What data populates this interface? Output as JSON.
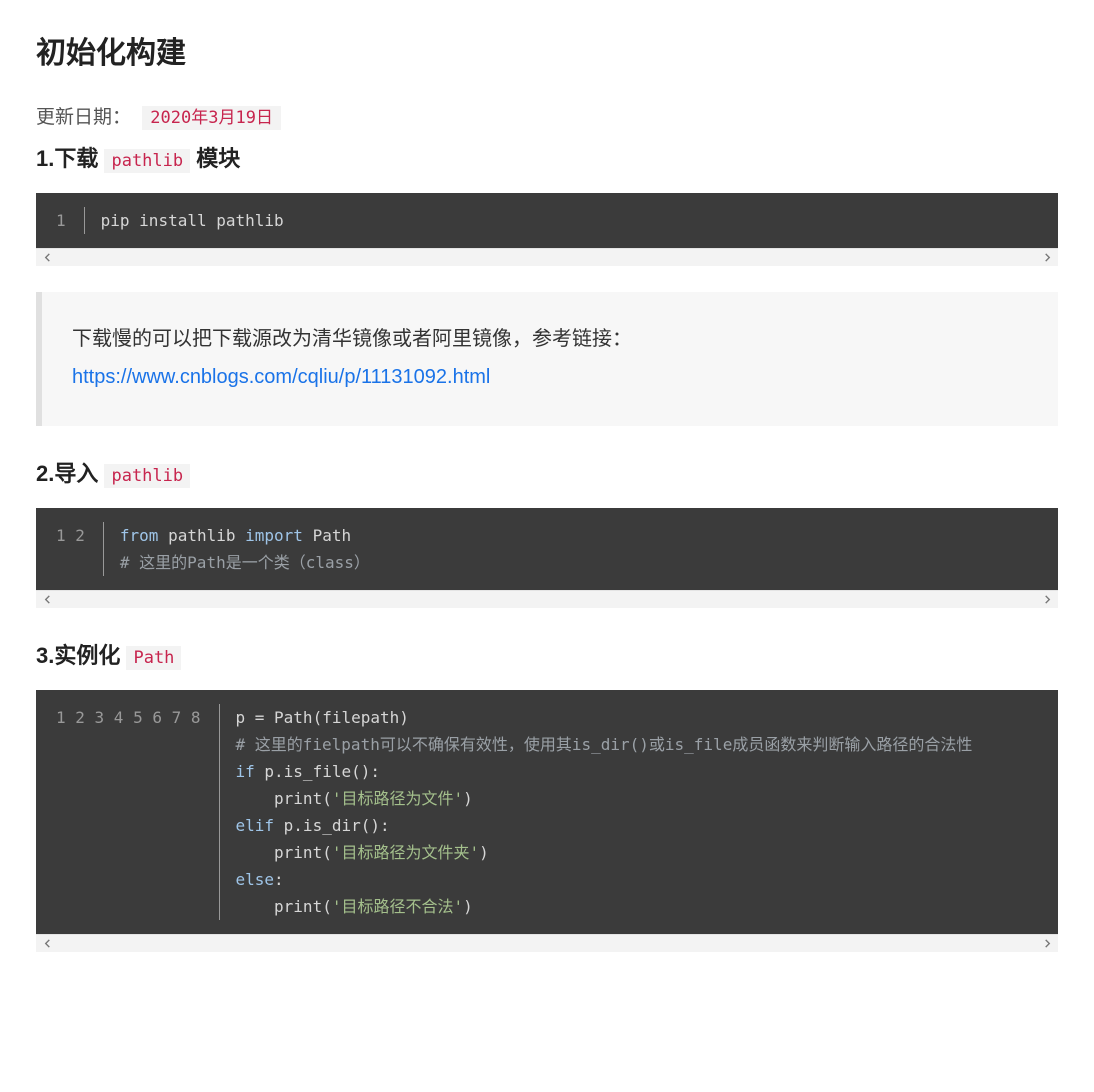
{
  "title": "初始化构建",
  "update_label": "更新日期：",
  "update_date": "2020年3月19日",
  "sections": {
    "s1": {
      "heading_prefix": "1.下载 ",
      "heading_code": "pathlib",
      "heading_suffix": " 模块",
      "code": {
        "gutter": "1",
        "lines": [
          {
            "plain": "pip install pathlib"
          }
        ]
      },
      "note_text": "下载慢的可以把下载源改为清华镜像或者阿里镜像，参考链接：",
      "note_link": "https://www.cnblogs.com/cqliu/p/11131092.html"
    },
    "s2": {
      "heading_prefix": "2.导入 ",
      "heading_code": "pathlib",
      "code": {
        "gutter": "1\n2",
        "line1_kw1": "from",
        "line1_mid": " pathlib ",
        "line1_kw2": "import",
        "line1_end": " Path",
        "line2_comment": "# 这里的Path是一个类（class）"
      }
    },
    "s3": {
      "heading_prefix": "3.实例化 ",
      "heading_code": "Path",
      "code": {
        "gutter": "1\n2\n3\n4\n5\n6\n7\n8",
        "l1": "p = Path(filepath)",
        "l2_comment": "# 这里的fielpath可以不确保有效性，使用其is_dir()或is_file成员函数来判断输入路径的合法性",
        "l3_kw": "if",
        "l3_rest": " p.is_file():",
        "l4_pre": "    print(",
        "l4_str": "'目标路径为文件'",
        "l4_post": ")",
        "l5_kw": "elif",
        "l5_rest": " p.is_dir():",
        "l6_pre": "    print(",
        "l6_str": "'目标路径为文件夹'",
        "l6_post": ")",
        "l7_kw": "else",
        "l7_rest": ":",
        "l8_pre": "    print(",
        "l8_str": "'目标路径不合法'",
        "l8_post": ")"
      }
    }
  }
}
